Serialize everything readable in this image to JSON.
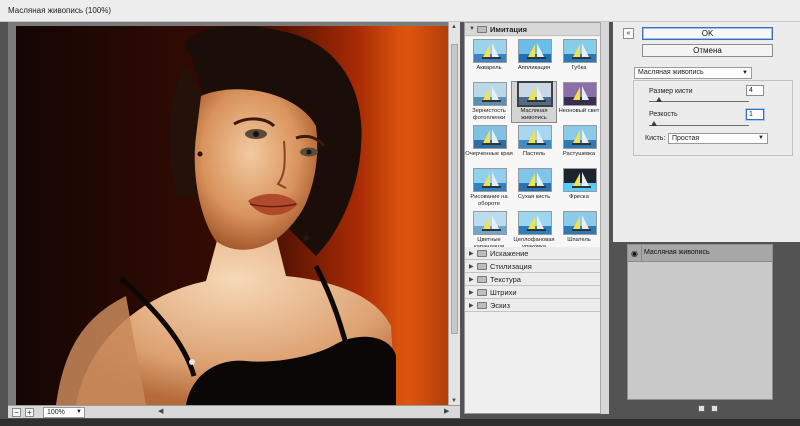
{
  "window": {
    "title": "Масляная живопись (100%)"
  },
  "zoom": {
    "value": "100%",
    "minus": "−",
    "plus": "+"
  },
  "gallery": {
    "open_category": "Имитация",
    "thumbnails": [
      {
        "label": "Акварель",
        "icon": "watercolor-thumb"
      },
      {
        "label": "Аппликация",
        "icon": "cutout-thumb"
      },
      {
        "label": "Губка",
        "icon": "sponge-thumb"
      },
      {
        "label": "Зернистость фотопленки",
        "icon": "film-grain-thumb"
      },
      {
        "label": "Масляная живопись",
        "icon": "oil-paint-thumb"
      },
      {
        "label": "Неоновый свет",
        "icon": "neon-glow-thumb"
      },
      {
        "label": "Очерченные края",
        "icon": "poster-edges-thumb"
      },
      {
        "label": "Пастель",
        "icon": "pastel-thumb"
      },
      {
        "label": "Растушевка",
        "icon": "smudge-thumb"
      },
      {
        "label": "Рисование на обороте",
        "icon": "underpainting-thumb"
      },
      {
        "label": "Сухая кисть",
        "icon": "dry-brush-thumb"
      },
      {
        "label": "Фреска",
        "icon": "fresco-thumb"
      },
      {
        "label": "Цветные карандаши",
        "icon": "colored-pencil-thumb"
      },
      {
        "label": "Целлофановая упаковка",
        "icon": "plastic-wrap-thumb"
      },
      {
        "label": "Шпатель",
        "icon": "palette-knife-thumb"
      }
    ],
    "selected_index": 4,
    "categories": [
      "Искажение",
      "Стилизация",
      "Текстура",
      "Штрихи",
      "Эскиз"
    ]
  },
  "settings": {
    "ok": "OK",
    "cancel": "Отмена",
    "filter": "Масляная живопись",
    "brush_size_label": "Размер кисти",
    "brush_size_value": "4",
    "brush_size_level": 0.1,
    "sharpness_label": "Резкость",
    "sharpness_value": "1",
    "sharpness_level": 0.05,
    "brush_label": "Кисть:",
    "brush_value": "Простая"
  },
  "layers": {
    "items": [
      "Масляная живопись"
    ]
  }
}
